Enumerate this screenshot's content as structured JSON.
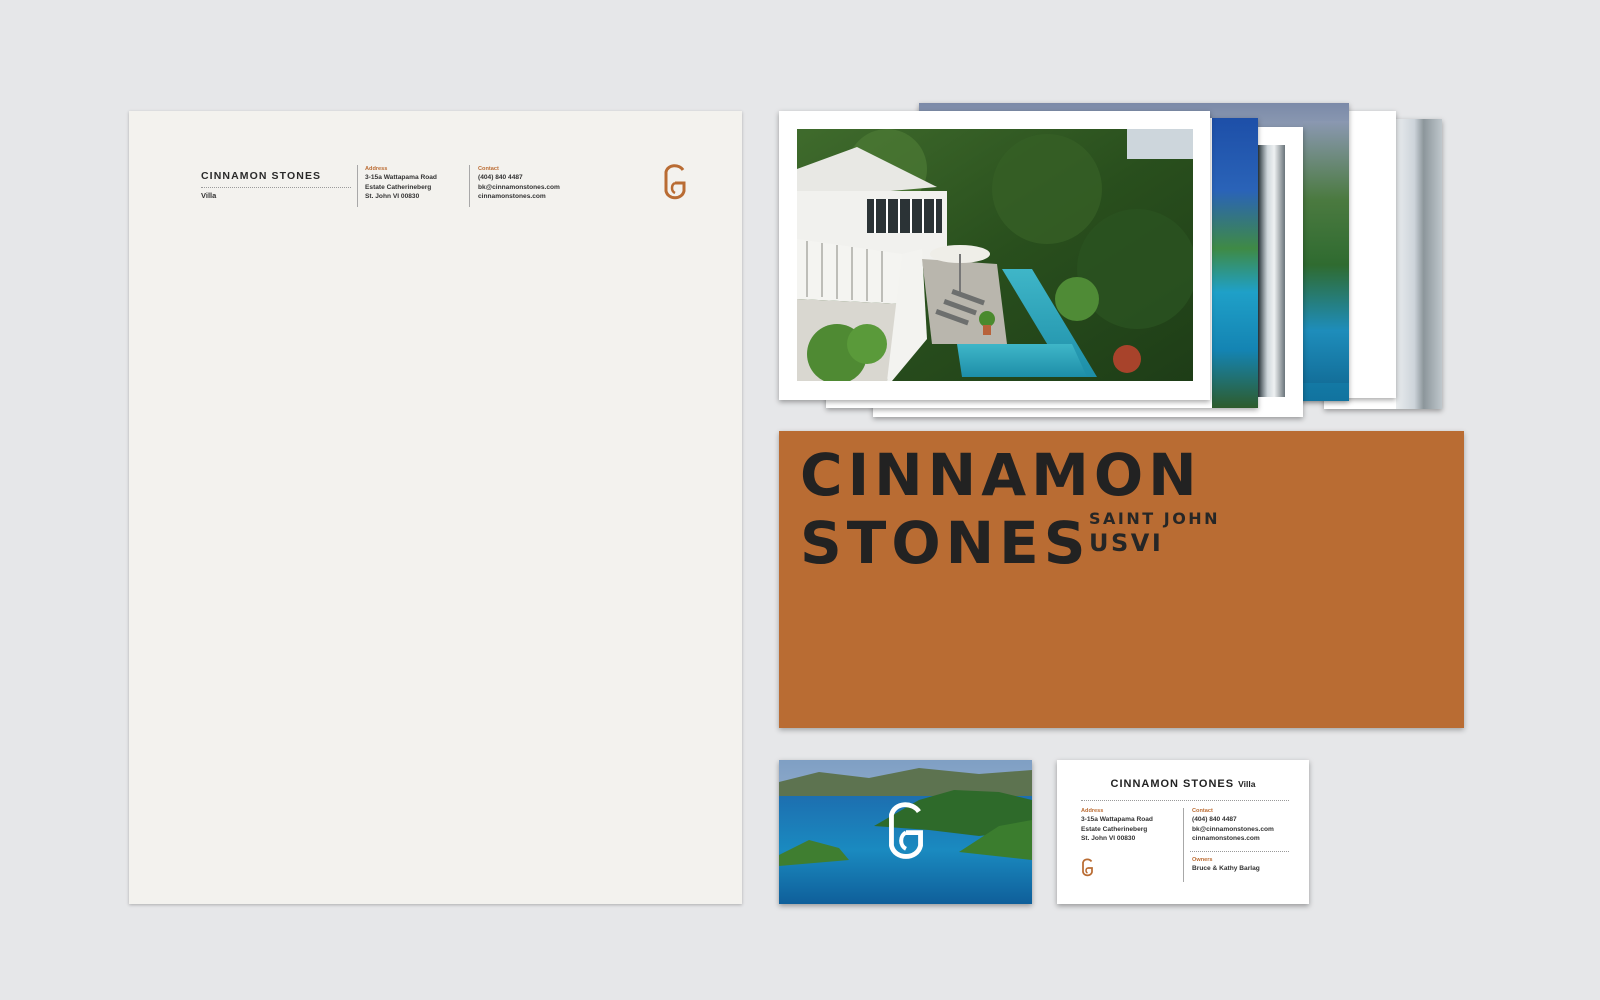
{
  "brand": {
    "name": "CINNAMON STONES",
    "subtitle": "Villa",
    "accent_color": "#b96c33",
    "logo_icon": "cg-monogram-icon"
  },
  "letterhead": {
    "name": "CINNAMON STONES",
    "subtitle": "Villa",
    "address_label": "Address",
    "address_lines": [
      "3-15a Wattapama Road",
      "Estate Catherineberg",
      "St. John  VI 00830"
    ],
    "contact_label": "Contact",
    "contact_lines": [
      "(404) 840 4487",
      "bk@cinnamonstones.com",
      "cinnamonstones.com"
    ]
  },
  "photo_cards": {
    "front_subject": "villa-pool-overlook-photo",
    "stacked_subjects": [
      "bay-view-photo",
      "porch-doorway-photo",
      "island-bay-photo",
      "bedroom-photo",
      "white-staircase-photo"
    ]
  },
  "folder": {
    "title_line1": "CINNAMON",
    "title_line2": "STONES",
    "location_line1": "SAINT JOHN",
    "location_line2": "USVI",
    "color": "#b96c33"
  },
  "business_card_front": {
    "subject": "island-seascape-photo",
    "logo_icon": "cg-monogram-icon"
  },
  "business_card_back": {
    "name": "CINNAMON STONES",
    "subtitle": "Villa",
    "address_label": "Address",
    "address_lines": [
      "3-15a Wattapama Road",
      "Estate Catherineberg",
      "St. John  VI 00830"
    ],
    "contact_label": "Contact",
    "contact_lines": [
      "(404) 840 4487",
      "bk@cinnamonstones.com",
      "cinnamonstones.com"
    ],
    "owners_label": "Owners",
    "owners": "Bruce & Kathy Barlag"
  }
}
